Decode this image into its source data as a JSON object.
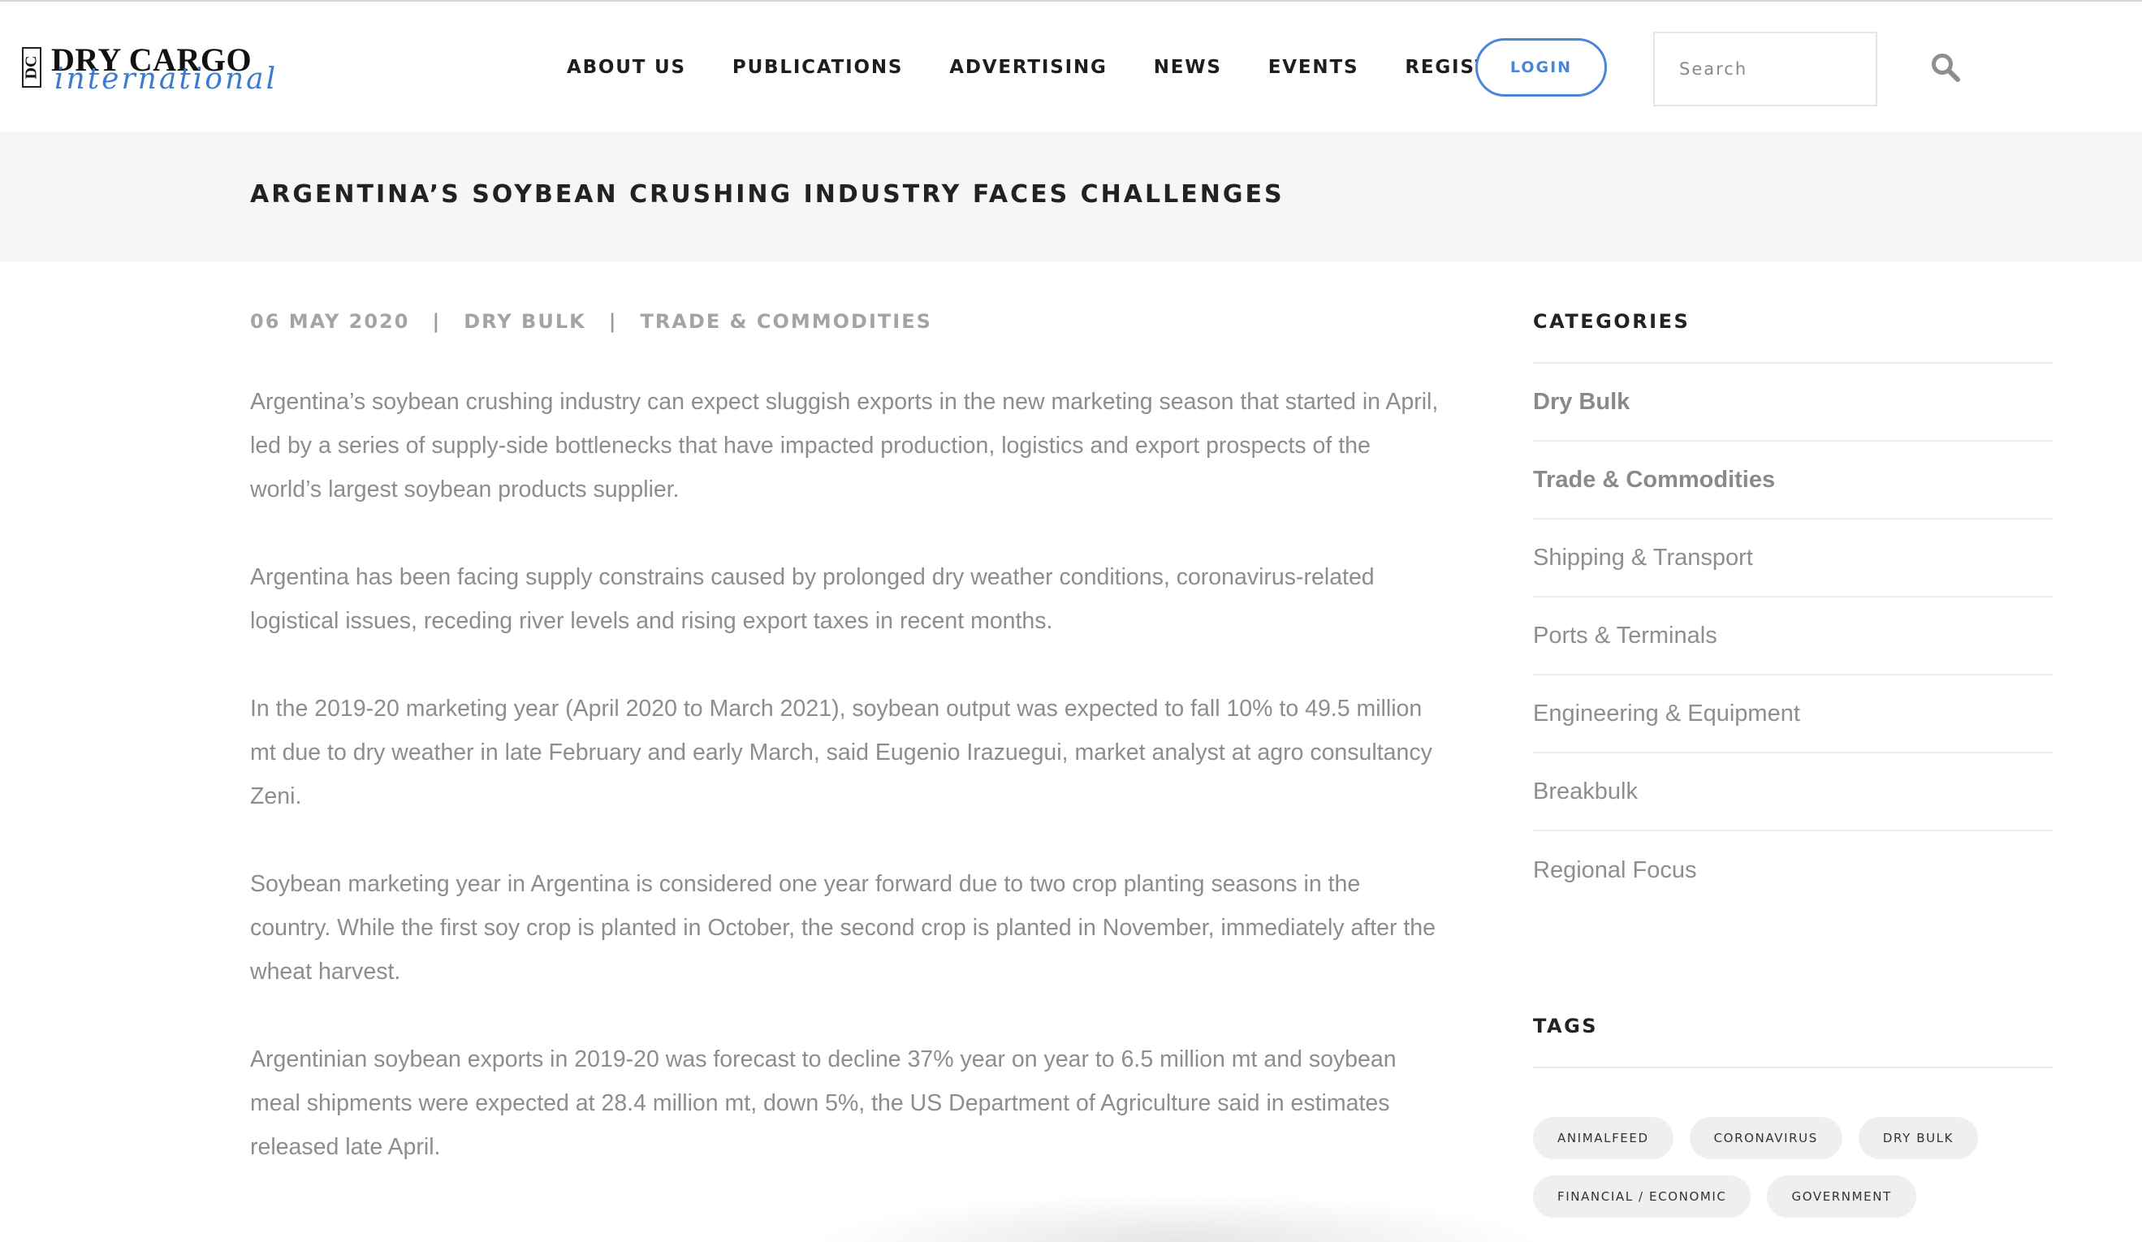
{
  "brand": {
    "logo_dc": "DC",
    "logo_main": "DRY CARGO",
    "logo_sub": "international"
  },
  "nav": {
    "items": [
      "ABOUT US",
      "PUBLICATIONS",
      "ADVERTISING",
      "NEWS",
      "EVENTS",
      "REGISTER"
    ]
  },
  "header": {
    "login_label": "LOGIN",
    "search_placeholder": "Search"
  },
  "article": {
    "title": "ARGENTINA’S SOYBEAN CRUSHING INDUSTRY FACES CHALLENGES",
    "date": "06 MAY 2020",
    "category_1": "DRY BULK",
    "category_2": "TRADE & COMMODITIES",
    "separator": "|",
    "paragraphs": [
      "Argentina’s soybean crushing industry can expect sluggish exports in the new marketing season that started in April, led by a series of supply-side bottlenecks that have impacted production, logistics and export prospects of the world’s largest soybean products supplier.",
      "Argentina has been facing supply constrains caused by prolonged dry weather conditions, coronavirus-related logistical issues, receding river levels and rising export taxes in recent months.",
      "In the 2019-20 marketing year (April 2020 to March 2021), soybean output was expected to fall 10% to 49.5 million mt due to dry weather in late February and early March, said Eugenio Irazuegui, market analyst at agro consultancy Zeni.",
      "Soybean marketing year in Argentina is considered one year forward due to two crop planting seasons in the country. While the first soy crop is planted in October, the second crop is planted in November, immediately after the wheat harvest.",
      "Argentinian soybean exports in 2019-20 was forecast to decline 37% year on year to 6.5 million mt and soybean meal shipments were expected at 28.4 million mt, down 5%, the US Department of Agriculture said in estimates released late April."
    ]
  },
  "sidebar": {
    "categories_heading": "CATEGORIES",
    "categories": [
      "Dry Bulk",
      "Trade & Commodities",
      "Shipping & Transport",
      "Ports & Terminals",
      "Engineering & Equipment",
      "Breakbulk",
      "Regional Focus"
    ],
    "active_categories": [
      "Dry Bulk",
      "Trade & Commodities"
    ],
    "tags_heading": "TAGS",
    "tags": [
      "ANIMALFEED",
      "CORONAVIRUS",
      "DRY BULK",
      "FINANCIAL / ECONOMIC",
      "GOVERNMENT"
    ]
  },
  "colors": {
    "accent": "#4a86d8",
    "text_muted": "#8d8d8d",
    "band": "#f6f6f6"
  }
}
